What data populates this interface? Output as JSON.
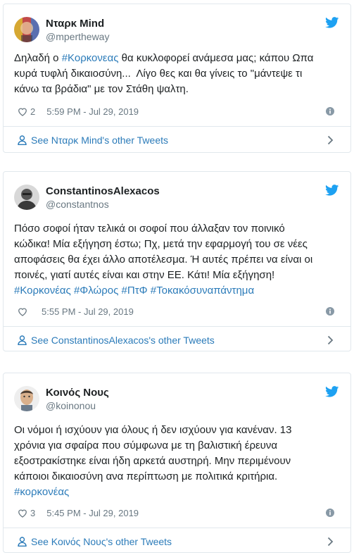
{
  "colors": {
    "link": "#2b7bb9",
    "twitter_blue": "#1da1f2",
    "muted": "#697882",
    "border": "#e1e8ed"
  },
  "tweets": [
    {
      "display_name": "Νταρκ Mind",
      "handle": "@mpertheway",
      "text_pre": "Δηλαδή ο ",
      "text_tag": "#Κορκονεας",
      "text_post": " θα κυκλοφορεί ανάμεσα μας; κάπου Ωπα\nκυρά τυφλή δικαιοσύνη...  Λίγο θες και θα γίνεις το \"μάντεψε τι\nκάνω τα βράδια\" με τον Στάθη ψαλτη.",
      "likes": "2",
      "timestamp": "5:59 PM - Jul 29, 2019",
      "footer_link": "See Νταρκ Mind's other Tweets"
    },
    {
      "display_name": "ConstantinosAlexacos",
      "handle": "@constantnos",
      "text_pre": "Πόσο σοφοί ήταν τελικά οι σοφοί που άλλαξαν τον ποινικό\nκώδικα! Μία εξήγηση έστω; Πχ, μετά την εφαρμογή του σε νέες\nαποφάσεις θα έχει άλλο αποτέλεσμα. Ή αυτές πρέπει να είναι οι\nποινές, γιατί αυτές είναι και στην ΕΕ. Κάτι! Μία εξήγηση!\n",
      "text_tag": "#Κορκονέας #Φλώρος #ΠτΦ #Τοκακόσυναπάντημα",
      "text_post": "",
      "likes": "",
      "timestamp": "5:55 PM - Jul 29, 2019",
      "footer_link": "See ConstantinosAlexacos's other Tweets"
    },
    {
      "display_name": "Κοινός Νους",
      "handle": "@koinonou",
      "text_pre": "Οι νόμοι ή ισχύουν για όλους ή δεν ισχύουν για κανέναν. 13\nχρόνια για σφαίρα που σύμφωνα με τη βαλιστική έρευνα\nεξοστρακίστηκε είναι ήδη αρκετά αυστηρή. Μην περιμένουν\nκάποιοι δικαιοσύνη ανα περίπτωση με πολιτικά κριτήρια.\n",
      "text_tag": "#κορκονέας",
      "text_post": "",
      "likes": "3",
      "timestamp": "5:45 PM - Jul 29, 2019",
      "footer_link": "See Κοινός Νους's other Tweets"
    }
  ]
}
